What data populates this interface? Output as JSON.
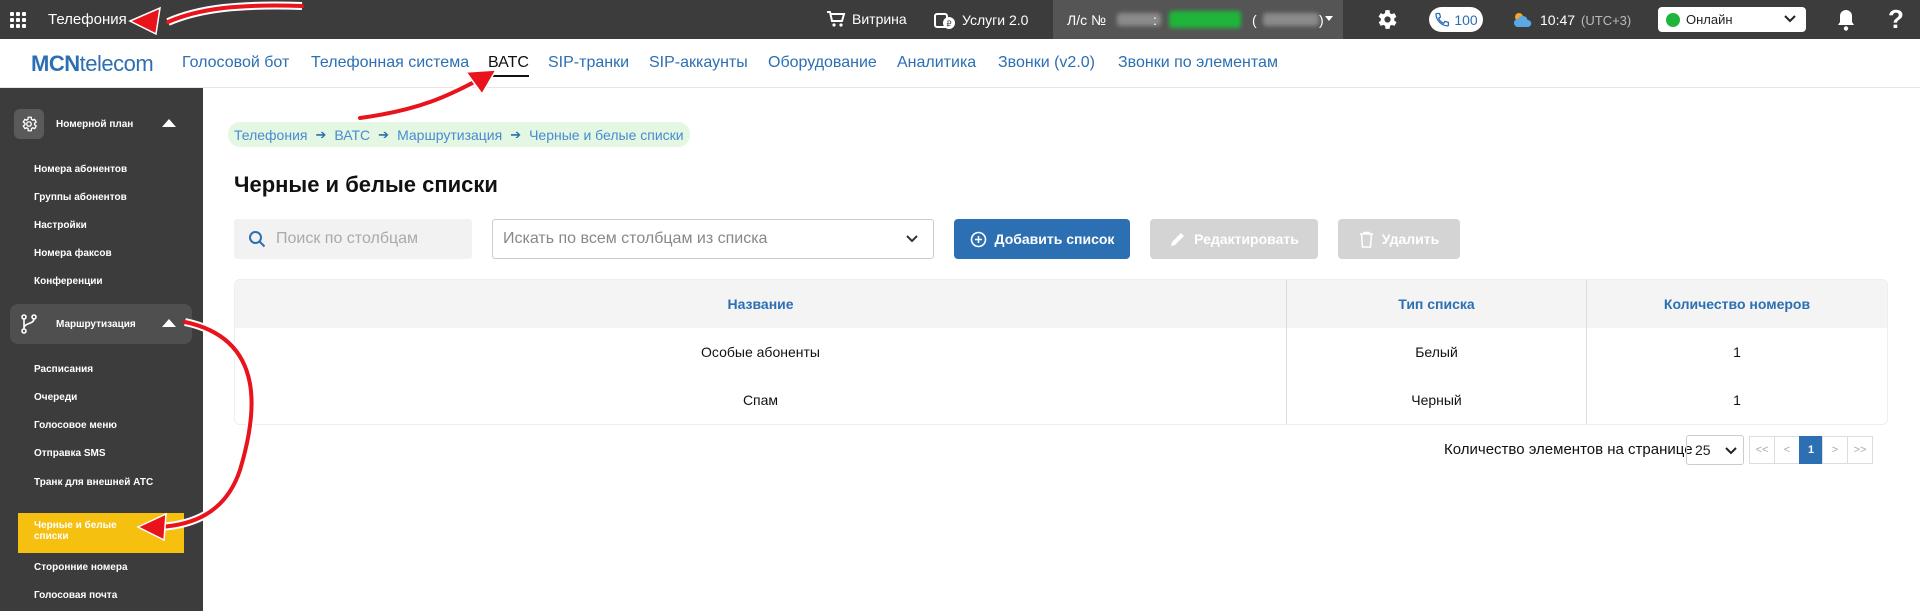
{
  "topbar": {
    "app_title": "Телефония",
    "vitrina": "Витрина",
    "services": "Услуги 2.0",
    "account_label": "Л/с №",
    "account_colon": ":",
    "account_paren_open": "(",
    "account_paren_close": ")",
    "calls_count": "100",
    "time": "10:47",
    "timezone": "(UTC+3)",
    "status": "Онлайн",
    "help": "?"
  },
  "nav": {
    "logo_bold": "MCN",
    "logo_light": "telecom",
    "links": [
      "Голосовой бот",
      "Телефонная система",
      "ВАТС",
      "SIP-транки",
      "SIP-аккаунты",
      "Оборудование",
      "Аналитика",
      "Звонки (v2.0)",
      "Звонки по элементам"
    ],
    "active": "ВАТС"
  },
  "sidebar": {
    "section1": "Номерной план",
    "section1_items": [
      "Номера абонентов",
      "Группы абонентов",
      "Настройки",
      "Номера факсов",
      "Конференции"
    ],
    "section2": "Маршрутизация",
    "section2_items": [
      "Расписания",
      "Очереди",
      "Голосовое меню",
      "Отправка SMS",
      "Транк для внешней АТС",
      "Черные и белые списки",
      "Сторонние номера",
      "Голосовая почта"
    ],
    "active_item": "Черные и белые списки"
  },
  "breadcrumb": [
    "Телефония",
    "ВАТС",
    "Маршрутизация",
    "Черные и белые списки"
  ],
  "page": {
    "title": "Черные и белые списки",
    "search_placeholder": "Поиск по столбцам",
    "column_select": "Искать по всем столбцам из списка",
    "add_button": "Добавить список",
    "edit_button": "Редактировать",
    "delete_button": "Удалить"
  },
  "table": {
    "headers": [
      "Название",
      "Тип списка",
      "Количество номеров"
    ],
    "rows": [
      [
        "Особые абоненты",
        "Белый",
        "1"
      ],
      [
        "Спам",
        "Черный",
        "1"
      ]
    ]
  },
  "pagination": {
    "label": "Количество элементов на странице",
    "per_page": "25",
    "first": "<<",
    "prev": "<",
    "current": "1",
    "next": ">",
    "last": ">>"
  },
  "colors": {
    "accent": "#2c6fb3",
    "topbar": "#3c3c3c",
    "active_item": "#f5c010",
    "annotation": "#e8131b"
  }
}
